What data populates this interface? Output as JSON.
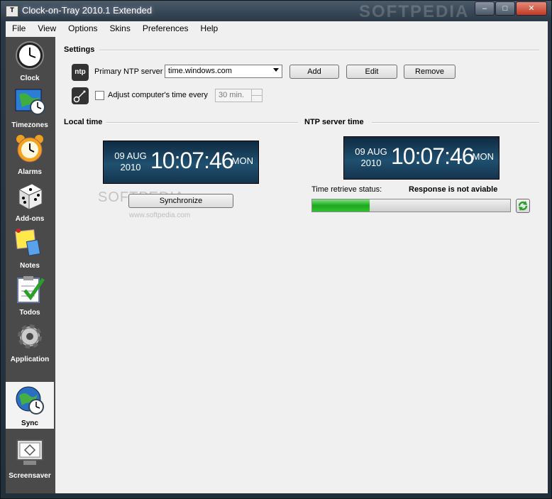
{
  "window": {
    "title": "Clock-on-Tray 2010.1 Extended",
    "watermark": "SOFTPEDIA",
    "controls": [
      "–",
      "□",
      "✕"
    ]
  },
  "menu": [
    "File",
    "View",
    "Options",
    "Skins",
    "Preferences",
    "Help"
  ],
  "sidebar": {
    "items": [
      {
        "label": "Clock",
        "icon": "clock-icon",
        "active": false
      },
      {
        "label": "Timezones",
        "icon": "timezones-icon",
        "active": false
      },
      {
        "label": "Alarms",
        "icon": "alarm-clock-icon",
        "active": false
      },
      {
        "label": "Add-ons",
        "icon": "dice-icon",
        "active": false
      },
      {
        "label": "Notes",
        "icon": "notes-icon",
        "active": false
      },
      {
        "label": "Todos",
        "icon": "todos-checklist-icon",
        "active": false
      },
      {
        "label": "Application",
        "icon": "gear-icon",
        "active": false
      },
      {
        "label": "Sync",
        "icon": "globe-clock-icon",
        "active": true
      },
      {
        "label": "Screensaver",
        "icon": "monitor-icon",
        "active": false
      }
    ]
  },
  "settings": {
    "title": "Settings",
    "ntp_badge": "ntp",
    "primary_label": "Primary NTP server",
    "server_value": "time.windows.com",
    "add_label": "Add",
    "edit_label": "Edit",
    "remove_label": "Remove",
    "adjust_label": "Adjust computer's time every",
    "adjust_checked": false,
    "interval_value": "30 min."
  },
  "local": {
    "title": "Local time",
    "date_line1": "09 AUG",
    "date_line2": "2010",
    "time": "10:07:46",
    "day": "MON",
    "sync_label": "Synchronize"
  },
  "ntp": {
    "title": "NTP server time",
    "date_line1": "09 AUG",
    "date_line2": "2010",
    "time": "10:07:46",
    "day": "MON",
    "status_label": "Time retrieve status:",
    "status_value": "Response is not aviable",
    "progress": 0.29
  },
  "watermark": {
    "text": "SOFTPEDIA",
    "url": "www.softpedia.com"
  },
  "colors": {
    "accent_green": "#1ea81e",
    "sidebar_bg": "#4a4a4a",
    "clock_bg": "#1f5070"
  }
}
